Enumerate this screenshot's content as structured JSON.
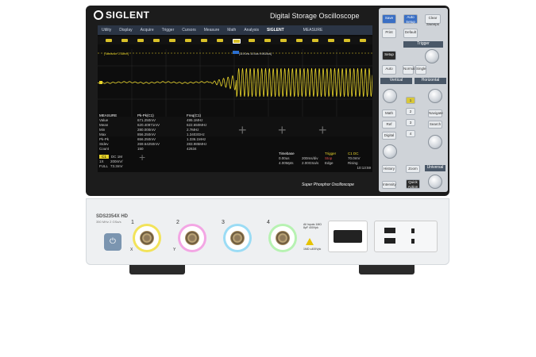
{
  "brand": {
    "logo": "SIGLENT",
    "product": "Digital Storage Oscilloscope",
    "model": "SDS2354X HD",
    "bandwidth": "350 MHz  2 GSa/s",
    "tagline": "Super Phosphor Oscilloscope",
    "spo": "SPO"
  },
  "menubar": {
    "items": [
      "Utility",
      "Display",
      "Acquire",
      "Trigger",
      "Cursors",
      "Measure",
      "Math",
      "Analysis"
    ],
    "signal": "SIGLENT",
    "measure": "MEASURE"
  },
  "trace_labels": {
    "left": "[Tolerance: 2.38mV]",
    "right": "[119.0ns  10.0us  9.9615us]"
  },
  "measure_table": {
    "headers": [
      "MEASURE",
      "Pk-Pk(C1)",
      "Freq(C1)"
    ],
    "rows": [
      [
        "Value",
        "671.250mV",
        "495.1MHz"
      ],
      [
        "Mean",
        "620.40971mV",
        "622.650MHz"
      ],
      [
        "Min",
        "280.000mV",
        "2.7MHz"
      ],
      [
        "Max",
        "856.250mV",
        "1.3403GHz"
      ],
      [
        "Pk-Pk",
        "656.250mV",
        "1.336.1MHz"
      ],
      [
        "Stdev",
        "269.64250mV",
        "283.985MHz"
      ],
      [
        "Count",
        "150",
        "42634"
      ]
    ]
  },
  "channel_box": {
    "c1": "C1",
    "dc": "DC 1M",
    "r1": [
      "1X",
      "200mV/"
    ],
    "r2": [
      "FULL",
      "73.3mV"
    ]
  },
  "timebase": {
    "headers": [
      "Timebase",
      "",
      "Trigger",
      "C1 DC"
    ],
    "rows": [
      [
        "0.00us",
        "200ms/div",
        "Stop",
        "70.0mV"
      ],
      [
        "4.00Mpts",
        "2.00GSa/s",
        "Edge",
        "Rising"
      ]
    ],
    "datetime": [
      "10:13:59",
      "2021/12/15"
    ]
  },
  "buttons": {
    "save": "Save",
    "auto": "Auto Setup",
    "clear": "Clear Sweeps",
    "print": "Print",
    "default": "Default",
    "trigger": "Trigger",
    "setup": "Setup",
    "auto_t": "Auto",
    "normal": "Normal",
    "single": "Single",
    "vertical": "Vertical",
    "horizontal": "Horizontal",
    "math": "Math",
    "ref": "Ref",
    "digital": "Digital",
    "history": "History",
    "search": "Search",
    "universal": "Universal",
    "intensity": "Intensity",
    "quick": "Quick Action",
    "ch": [
      "1",
      "2",
      "3",
      "4"
    ],
    "level": "Level",
    "position": "Position",
    "variable": "Variable",
    "navigate": "Navigate",
    "zoom": "Zoom"
  },
  "inputs": {
    "channels": [
      "1",
      "2",
      "3",
      "4"
    ],
    "x": "X",
    "y": "Y",
    "warning": "!",
    "port_note": "All Inputs 1MΩ 8pF 400Vpk",
    "coupling_note": "1MΩ  ≤400Vpk"
  },
  "colors": {
    "c1": "#e8d42a",
    "c2": "#f08ad8",
    "c3": "#58c8f0",
    "c4": "#7ff07a"
  }
}
